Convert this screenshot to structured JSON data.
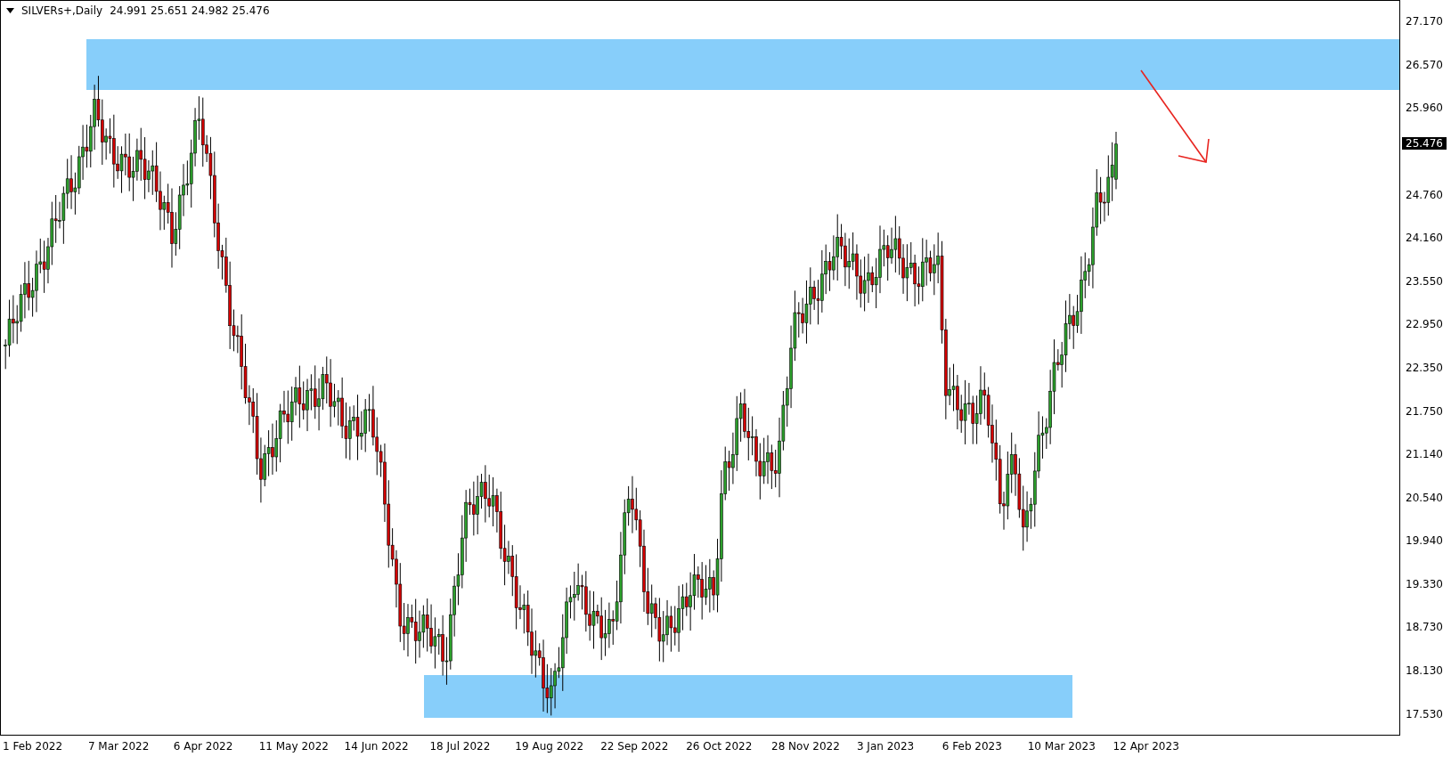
{
  "header": {
    "symbol": "SILVERs+,Daily",
    "ohlc": "24.991 25.651 24.982 25.476"
  },
  "price_axis": {
    "labels_above": [
      "27.170",
      "26.570",
      "25.960"
    ],
    "labels_below": [
      "24.760",
      "24.160",
      "23.550",
      "22.950",
      "22.350",
      "21.750",
      "21.140",
      "20.540",
      "19.940",
      "19.330",
      "18.730",
      "18.130",
      "17.530"
    ]
  },
  "current_price": "25.476",
  "time_axis": {
    "labels": [
      "1 Feb 2022",
      "7 Mar 2022",
      "6 Apr 2022",
      "11 May 2022",
      "14 Jun 2022",
      "18 Jul 2022",
      "19 Aug 2022",
      "22 Sep 2022",
      "26 Oct 2022",
      "28 Nov 2022",
      "3 Jan 2023",
      "6 Feb 2023",
      "10 Mar 2023",
      "12 Apr 2023"
    ]
  }
}
